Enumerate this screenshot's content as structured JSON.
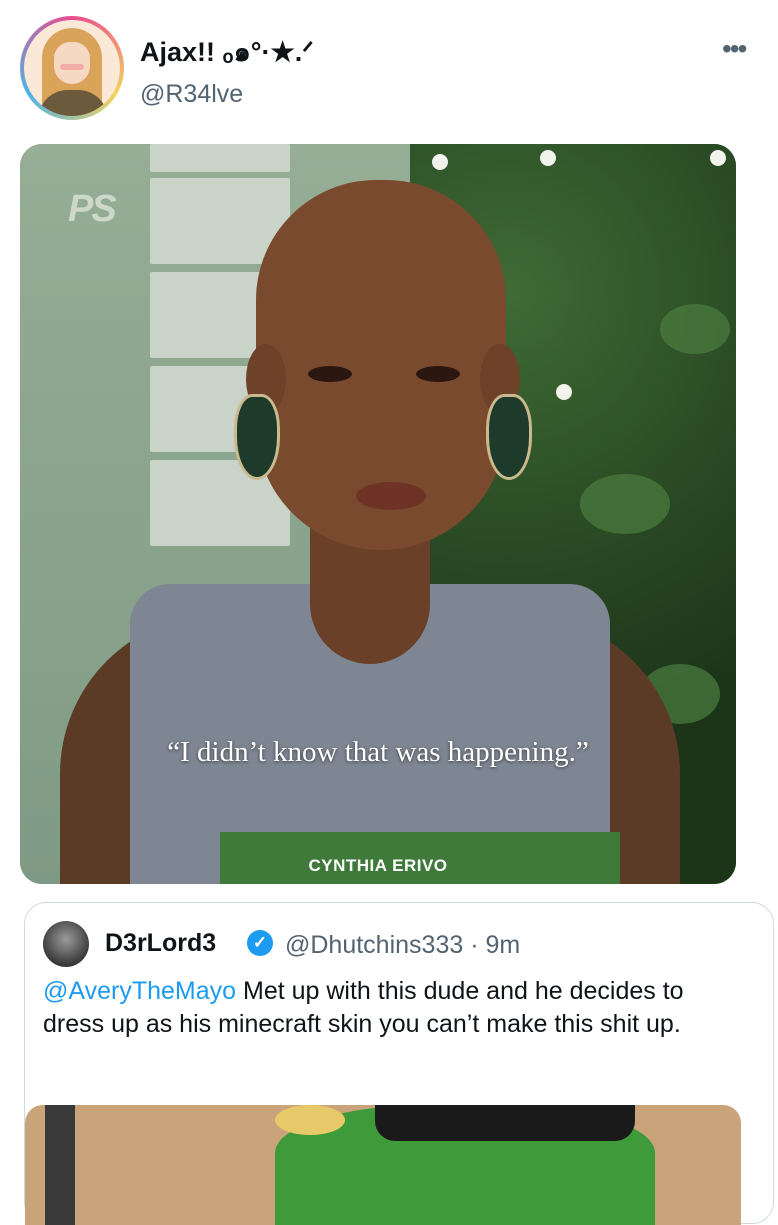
{
  "tweet": {
    "display_name": "Ajax!! ₒ๑°·★.ᐟ",
    "handle": "@R34lve",
    "more_icon": "more-horizontal-icon"
  },
  "media": {
    "watermark": "PS",
    "quote": "“I didn’t know that was happening.”",
    "caption": "CYNTHIA ERIVO"
  },
  "quoted_tweet": {
    "display_name": "D3rLord3",
    "verified_icon": "verified-badge-icon",
    "handle_time": "@Dhutchins333 · 9m",
    "mention": "@AveryTheMayo",
    "text": " Met up with this dude and he decides to dress up as his minecraft skin you can’t make this shit up."
  },
  "colors": {
    "link": "#1d9bf0",
    "secondary_text": "#536471",
    "border": "#cfd9de"
  }
}
